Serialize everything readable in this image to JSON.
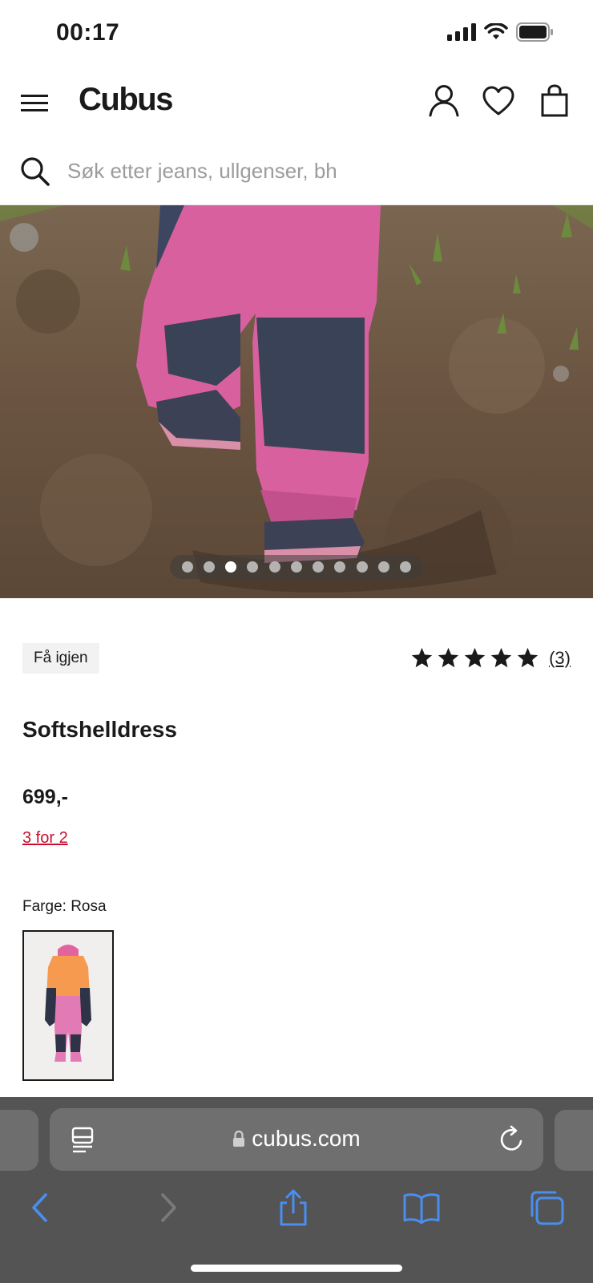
{
  "status_bar": {
    "time": "00:17"
  },
  "header": {
    "logo": "Cubus",
    "icons": [
      "hamburger-menu-icon",
      "user-icon",
      "heart-icon",
      "shopping-bag-icon"
    ]
  },
  "search": {
    "placeholder": "Søk etter jeans, ullgenser, bh"
  },
  "gallery": {
    "image_count": 11,
    "active_index": 3
  },
  "product": {
    "badge": "Få igjen",
    "rating_stars": 5,
    "rating_count": "(3)",
    "title": "Softshelldress",
    "price": "699,-",
    "promo": "3 for 2",
    "color_label": "Farge: Rosa"
  },
  "browser": {
    "url": "cubus.com",
    "icons": [
      "reader-icon",
      "lock-icon",
      "reload-icon",
      "back-icon",
      "forward-icon",
      "share-icon",
      "bookmarks-icon",
      "tabs-icon"
    ]
  },
  "colors": {
    "promo": "#c8102e",
    "browser_bar": "#545454",
    "browser_accent": "#3b82f6"
  }
}
